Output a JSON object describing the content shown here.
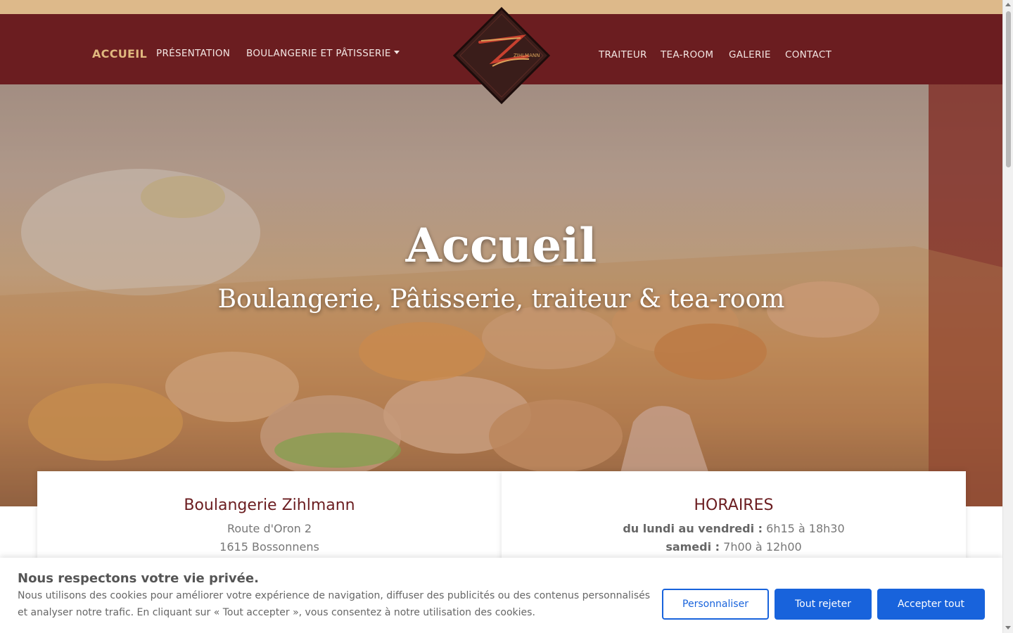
{
  "nav": {
    "left_items": [
      {
        "label": "ACCUEIL",
        "active": true
      },
      {
        "label": "PRÉSENTATION"
      },
      {
        "label": "BOULANGERIE ET PÂTISSERIE",
        "dropdown": true
      }
    ],
    "right_items": [
      {
        "label": "TRAITEUR"
      },
      {
        "label": "TEA-ROOM"
      },
      {
        "label": "GALERIE"
      },
      {
        "label": "CONTACT"
      }
    ],
    "logo_text": "ZIHLMANN"
  },
  "hero": {
    "title": "Accueil",
    "subtitle": "Boulangerie, Pâtisserie, traiteur & tea-room"
  },
  "address_card": {
    "title": "Boulangerie Zihlmann",
    "line1": "Route d'Oron 2",
    "line2": "1615 Bossonnens"
  },
  "hours_card": {
    "title": "HORAIRES",
    "row1_label": "du lundi au vendredi :",
    "row1_value": "6h15 à 18h30",
    "row2_label": "samedi :",
    "row2_value": "7h00 à 12h00"
  },
  "cookie": {
    "title": "Nous respectons votre vie privée.",
    "text": "Nous utilisons des cookies pour améliorer votre expérience de navigation, diffuser des publicités ou des contenus personnalisés et analyser notre trafic. En cliquant sur « Tout accepter », vous consentez à notre utilisation des cookies.",
    "customize_label": "Personnaliser",
    "reject_label": "Tout rejeter",
    "accept_label": "Accepter tout"
  },
  "colors": {
    "topbar": "#ddb98a",
    "navbar": "#6b1d20",
    "nav_active": "#e0b77e",
    "accent_blue": "#1863dc"
  }
}
